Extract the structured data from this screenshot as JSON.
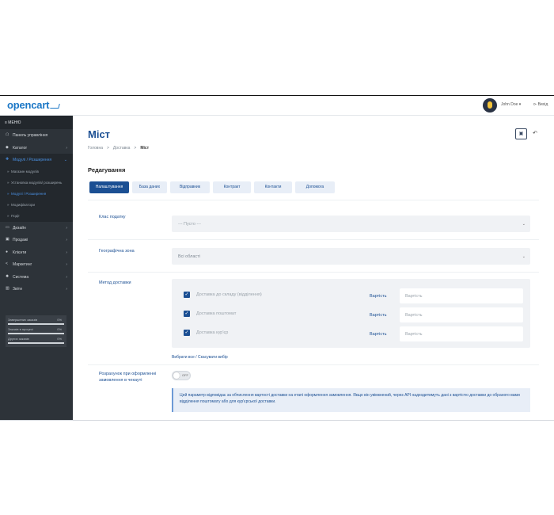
{
  "header": {
    "logo": "opencart",
    "user_name": "John Doe ▾",
    "logout": "⊳ Вихід"
  },
  "sidebar": {
    "menu_label": "≡ МЕНЮ",
    "items": [
      {
        "label": "Панель управління",
        "icon": "dashboard-icon",
        "glyph": "☖"
      },
      {
        "label": "Каталог",
        "icon": "tag-icon",
        "glyph": "◆"
      },
      {
        "label": "Модулі / Розширення",
        "icon": "puzzle-icon",
        "glyph": "✚",
        "active": true
      },
      {
        "label": "Дизайн",
        "icon": "desktop-icon",
        "glyph": "▭"
      },
      {
        "label": "Продажі",
        "icon": "cart-icon",
        "glyph": "▣"
      },
      {
        "label": "Клієнти",
        "icon": "user-icon",
        "glyph": "●"
      },
      {
        "label": "Маркетинг",
        "icon": "share-icon",
        "glyph": "<"
      },
      {
        "label": "Система",
        "icon": "gear-icon",
        "glyph": "✹"
      },
      {
        "label": "Звіти",
        "icon": "chart-icon",
        "glyph": "▥"
      }
    ],
    "sub_items": [
      {
        "label": "Магазин модулів"
      },
      {
        "label": "Установка модулів/ розширень"
      },
      {
        "label": "Модулі / Розширення",
        "active": true
      },
      {
        "label": "Модифікатори"
      },
      {
        "label": "Події"
      }
    ],
    "stats": [
      {
        "label": "Завершених заказів",
        "value": "0%"
      },
      {
        "label": "Заказів в процесі",
        "value": "0%"
      },
      {
        "label": "Других заказів",
        "value": "0%"
      }
    ]
  },
  "main": {
    "title": "Міст",
    "breadcrumb": [
      "Головна",
      ">",
      "Доставка",
      ">",
      "Міст"
    ],
    "section_title": "Редагування",
    "tabs": [
      {
        "label": "Налаштування",
        "active": true
      },
      {
        "label": "База даних"
      },
      {
        "label": "Відправник"
      },
      {
        "label": "Контракт"
      },
      {
        "label": "Контакти"
      },
      {
        "label": "Допомога"
      }
    ],
    "tax_class": {
      "label": "Клас податку",
      "value": "--- Пусто ---"
    },
    "geo_zone": {
      "label": "Географічна зона",
      "value": "Всі області"
    },
    "delivery_method": {
      "label": "Метод доставки",
      "price_label": "Вартість",
      "price_placeholder": "Вартість",
      "options": [
        {
          "label": "Доставка до складу (відділення)",
          "checked": true
        },
        {
          "label": "Доставка поштомат",
          "checked": true
        },
        {
          "label": "Доставка кур'єр",
          "checked": true
        }
      ],
      "select_all": "Вибрати все / Скасувати вибір"
    },
    "checkout_calc": {
      "label": "Розрахунок при оформленні замовлення в чекауті",
      "toggle": "OFF",
      "help": "Цей параметр відповідає за обчислення вартості доставки на етапі оформлення замовлення. Якщо він увімкнений, через API надходитимуть дані з вартістю доставки до обраного вами відділення поштомату або для кур'єрської доставки."
    }
  }
}
